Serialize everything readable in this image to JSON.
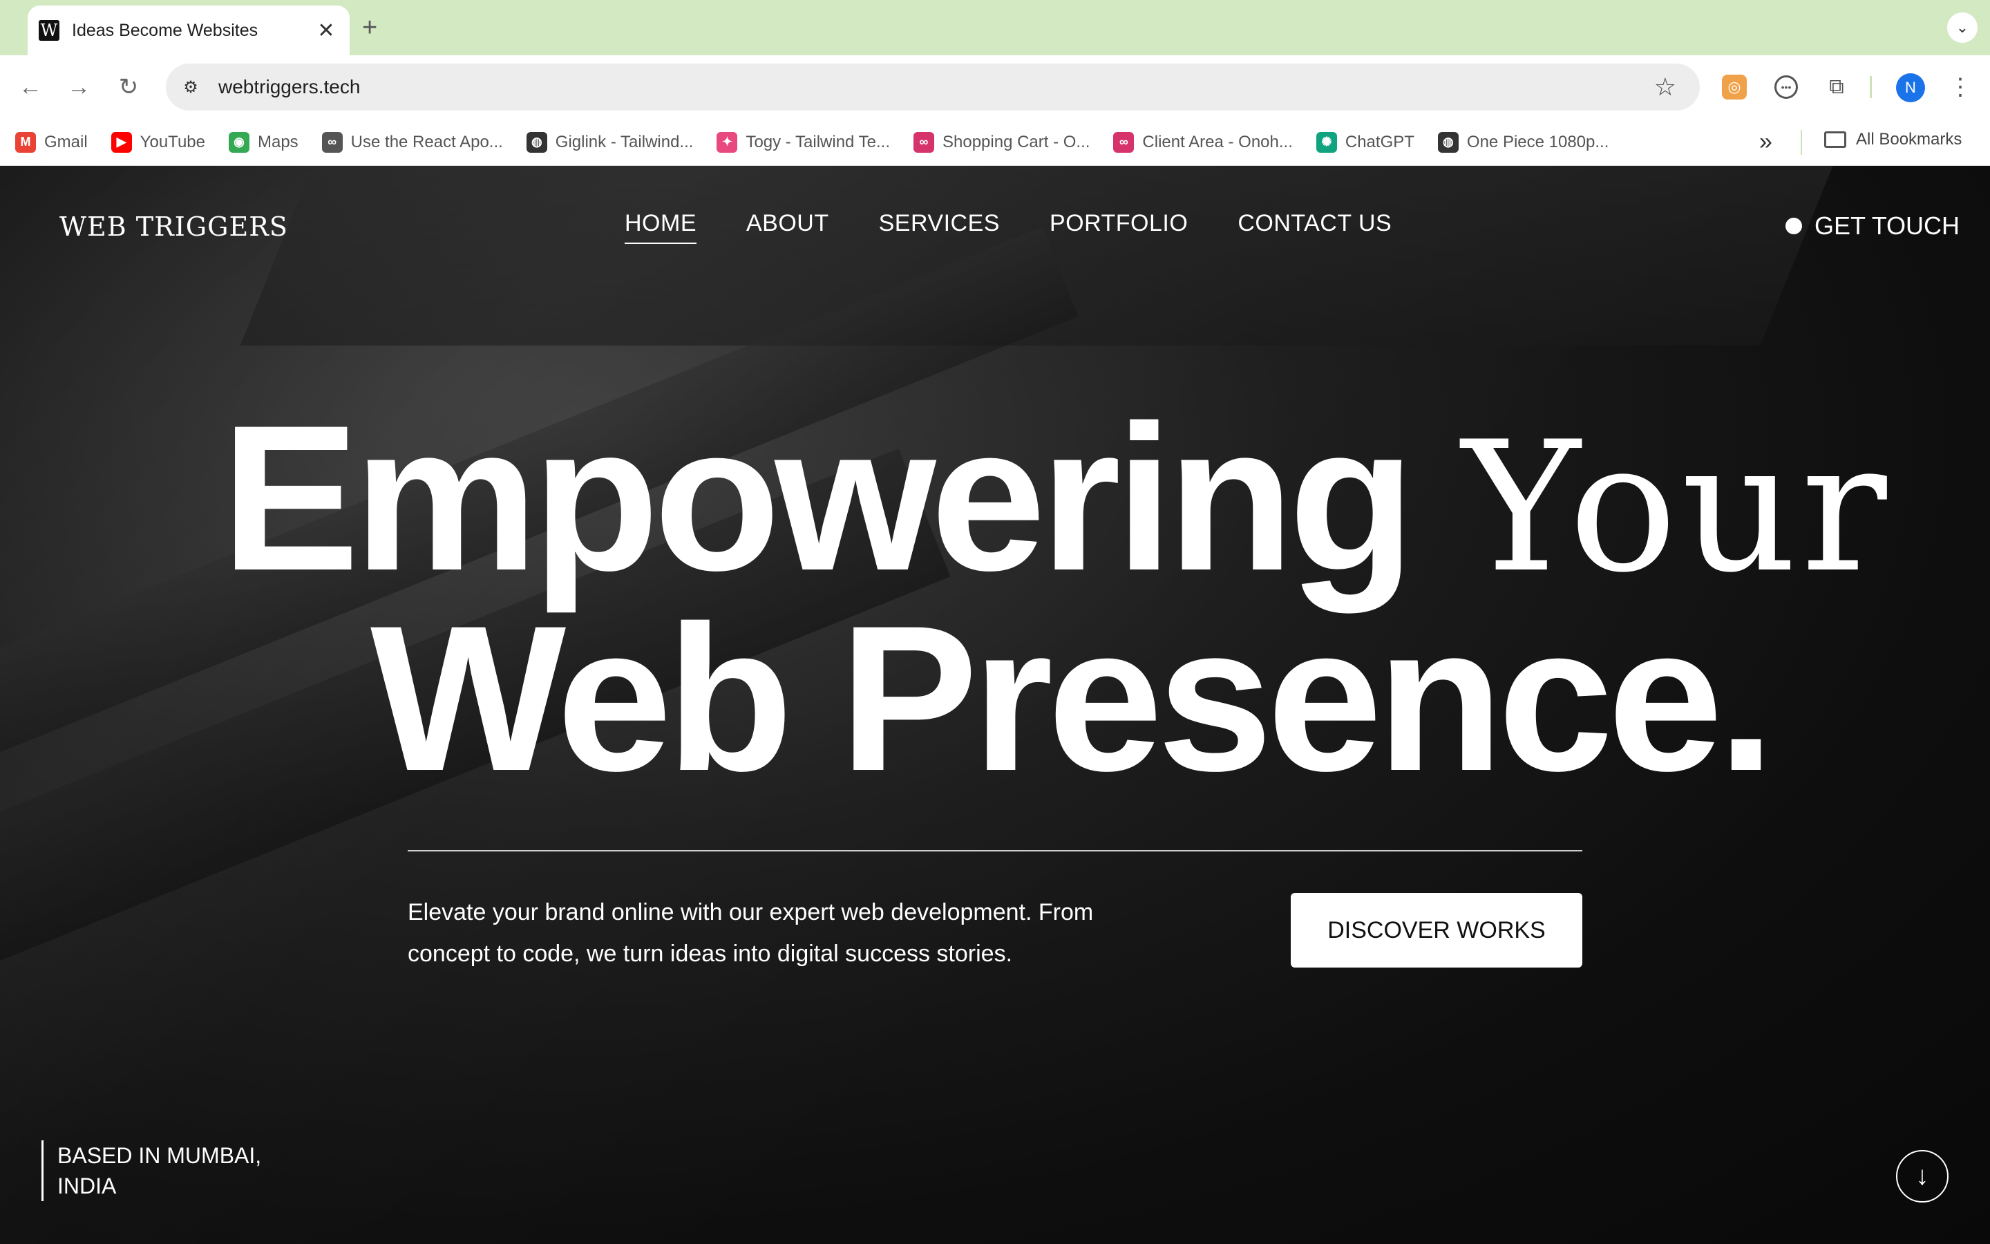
{
  "browser": {
    "tab_title": "Ideas Become Websites",
    "favicon_letter": "W",
    "url": "webtriggers.tech",
    "profile_initial": "N",
    "bookmarks": [
      {
        "label": "Gmail",
        "icon": "gmail-icon",
        "color": "#ea4335"
      },
      {
        "label": "YouTube",
        "icon": "youtube-icon",
        "color": "#ff0000"
      },
      {
        "label": "Maps",
        "icon": "maps-icon",
        "color": "#34a853"
      },
      {
        "label": "Use the React Apo...",
        "icon": "glasses-icon",
        "color": "#555555"
      },
      {
        "label": "Giglink - Tailwind...",
        "icon": "globe-icon",
        "color": "#333333"
      },
      {
        "label": "Togy - Tailwind Te...",
        "icon": "bird-icon",
        "color": "#e84a7f"
      },
      {
        "label": "Shopping Cart - O...",
        "icon": "glasses-pink-icon",
        "color": "#d6336c"
      },
      {
        "label": "Client Area - Onoh...",
        "icon": "glasses-pink-icon",
        "color": "#d6336c"
      },
      {
        "label": "ChatGPT",
        "icon": "chatgpt-icon",
        "color": "#10a37f"
      },
      {
        "label": "One Piece 1080p...",
        "icon": "globe-icon",
        "color": "#333333"
      }
    ],
    "all_bookmarks": "All Bookmarks"
  },
  "site": {
    "logo": "WEB TRIGGERS",
    "nav": [
      "HOME",
      "ABOUT",
      "SERVICES",
      "PORTFOLIO",
      "CONTACT US"
    ],
    "active_nav": "HOME",
    "cta_top": "GET TOUCH",
    "hero": {
      "line1_sans": "Empowering",
      "line1_serif": "Your",
      "line2": "Web Presence."
    },
    "description": "Elevate your brand online with our expert web development. From concept to code, we turn ideas into digital success stories.",
    "discover_button": "DISCOVER WORKS",
    "location": "BASED IN MUMBAI, INDIA"
  }
}
